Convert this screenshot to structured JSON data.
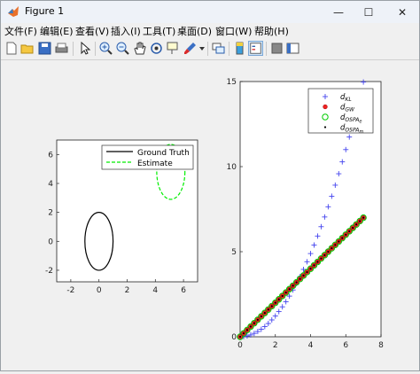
{
  "window": {
    "title": "Figure 1"
  },
  "controls": {
    "minimize": "—",
    "maximize": "☐",
    "close": "✕"
  },
  "menubar": {
    "items": [
      {
        "label": "文件(F)"
      },
      {
        "label": "编辑(E)"
      },
      {
        "label": "查看(V)"
      },
      {
        "label": "插入(I)"
      },
      {
        "label": "工具(T)"
      },
      {
        "label": "桌面(D)"
      },
      {
        "label": "窗口(W)"
      },
      {
        "label": "帮助(H)"
      }
    ]
  },
  "toolbar": {
    "icons": [
      "new-figure-icon",
      "open-file-icon",
      "save-icon",
      "print-icon",
      "edit-plot-icon",
      "zoom-in-icon",
      "zoom-out-icon",
      "pan-icon",
      "rotate-3d-icon",
      "data-cursor-icon",
      "brush-icon",
      "brush-dropdown-icon",
      "link-plot-icon",
      "colorbar-icon",
      "legend-icon",
      "hide-plot-tools-icon",
      "show-plot-tools-icon"
    ]
  },
  "chart_data": [
    {
      "type": "line",
      "xlim": [
        -3,
        7
      ],
      "ylim": [
        -2.8,
        7
      ],
      "xticks": [
        "-2",
        "0",
        "2",
        "4",
        "6"
      ],
      "yticks": [
        "-2",
        "0",
        "2",
        "4",
        "6"
      ],
      "grid": false,
      "legend_position": "top-right",
      "series": [
        {
          "name": "Ground Truth",
          "color": "#000000",
          "style": "solid",
          "ellipse": {
            "cx": 0,
            "cy": 0,
            "rx": 1,
            "ry": 2
          }
        },
        {
          "name": "Estimate",
          "color": "#00ee00",
          "style": "dashed",
          "ellipse": {
            "cx": 5.1,
            "cy": 4.8,
            "rx": 1,
            "ry": 1.9
          }
        }
      ]
    },
    {
      "type": "scatter",
      "xlim": [
        0,
        8
      ],
      "ylim": [
        0,
        15
      ],
      "xticks": [
        "0",
        "2",
        "4",
        "6",
        "8"
      ],
      "yticks": [
        "0",
        "5",
        "10",
        "15"
      ],
      "grid": false,
      "legend_position": "top-right",
      "series": [
        {
          "name": "d_KL",
          "label_main": "d",
          "label_sub": "KL",
          "marker": "+",
          "color": "#4444ee",
          "x": [
            0,
            0.2,
            0.4,
            0.6,
            0.8,
            1.0,
            1.2,
            1.4,
            1.6,
            1.8,
            2.0,
            2.2,
            2.4,
            2.6,
            2.8,
            3.0,
            3.2,
            3.4,
            3.6,
            3.8,
            4.0,
            4.2,
            4.4,
            4.6,
            4.8,
            5.0,
            5.2,
            5.4,
            5.6,
            5.8,
            6.0,
            6.2,
            6.4,
            6.6,
            6.8,
            7.0
          ],
          "y": [
            0.0,
            0.01,
            0.05,
            0.11,
            0.2,
            0.31,
            0.44,
            0.6,
            0.78,
            0.99,
            1.22,
            1.48,
            1.76,
            2.06,
            2.39,
            2.75,
            3.13,
            3.53,
            3.96,
            4.41,
            4.89,
            5.39,
            5.92,
            6.47,
            7.04,
            7.64,
            8.26,
            8.91,
            9.58,
            10.28,
            11.0,
            11.74,
            12.51,
            13.31,
            14.13,
            14.97
          ]
        },
        {
          "name": "d_GW",
          "label_main": "d",
          "label_sub": "GW",
          "marker": "*",
          "color": "#ee2222",
          "x": [
            0,
            0.2,
            0.4,
            0.6,
            0.8,
            1.0,
            1.2,
            1.4,
            1.6,
            1.8,
            2.0,
            2.2,
            2.4,
            2.6,
            2.8,
            3.0,
            3.2,
            3.4,
            3.6,
            3.8,
            4.0,
            4.2,
            4.4,
            4.6,
            4.8,
            5.0,
            5.2,
            5.4,
            5.6,
            5.8,
            6.0,
            6.2,
            6.4,
            6.6,
            6.8,
            7.0
          ],
          "y": [
            0,
            0.2,
            0.4,
            0.6,
            0.8,
            1.0,
            1.2,
            1.4,
            1.6,
            1.8,
            2.0,
            2.2,
            2.4,
            2.6,
            2.8,
            3.0,
            3.2,
            3.4,
            3.6,
            3.8,
            4.0,
            4.2,
            4.4,
            4.6,
            4.8,
            5.0,
            5.2,
            5.4,
            5.6,
            5.8,
            6.0,
            6.2,
            6.4,
            6.6,
            6.8,
            7.0
          ]
        },
        {
          "name": "d_OSPA_e",
          "label_main": "d",
          "label_sub": "OSPA",
          "label_subsub": "e",
          "marker": "o",
          "color": "#00cc00",
          "x": [
            0,
            0.2,
            0.4,
            0.6,
            0.8,
            1.0,
            1.2,
            1.4,
            1.6,
            1.8,
            2.0,
            2.2,
            2.4,
            2.6,
            2.8,
            3.0,
            3.2,
            3.4,
            3.6,
            3.8,
            4.0,
            4.2,
            4.4,
            4.6,
            4.8,
            5.0,
            5.2,
            5.4,
            5.6,
            5.8,
            6.0,
            6.2,
            6.4,
            6.6,
            6.8,
            7.0
          ],
          "y": [
            0,
            0.2,
            0.4,
            0.6,
            0.8,
            1.0,
            1.2,
            1.4,
            1.6,
            1.8,
            2.0,
            2.2,
            2.4,
            2.6,
            2.8,
            3.0,
            3.2,
            3.4,
            3.6,
            3.8,
            4.0,
            4.2,
            4.4,
            4.6,
            4.8,
            5.0,
            5.2,
            5.4,
            5.6,
            5.8,
            6.0,
            6.2,
            6.4,
            6.6,
            6.8,
            7.0
          ]
        },
        {
          "name": "d_OSPA_m",
          "label_main": "d",
          "label_sub": "OSPA",
          "label_subsub": "m",
          "marker": ".",
          "color": "#000000",
          "x": [
            0,
            0.2,
            0.4,
            0.6,
            0.8,
            1.0,
            1.2,
            1.4,
            1.6,
            1.8,
            2.0,
            2.2,
            2.4,
            2.6,
            2.8,
            3.0,
            3.2,
            3.4,
            3.6,
            3.8,
            4.0,
            4.2,
            4.4,
            4.6,
            4.8,
            5.0,
            5.2,
            5.4,
            5.6,
            5.8,
            6.0,
            6.2,
            6.4,
            6.6,
            6.8,
            7.0
          ],
          "y": [
            0,
            0.2,
            0.4,
            0.6,
            0.8,
            1.0,
            1.2,
            1.4,
            1.6,
            1.8,
            2.0,
            2.2,
            2.4,
            2.6,
            2.8,
            3.0,
            3.2,
            3.4,
            3.6,
            3.8,
            4.0,
            4.2,
            4.4,
            4.6,
            4.8,
            5.0,
            5.2,
            5.4,
            5.6,
            5.8,
            6.0,
            6.2,
            6.4,
            6.6,
            6.8,
            7.0
          ]
        }
      ]
    }
  ]
}
